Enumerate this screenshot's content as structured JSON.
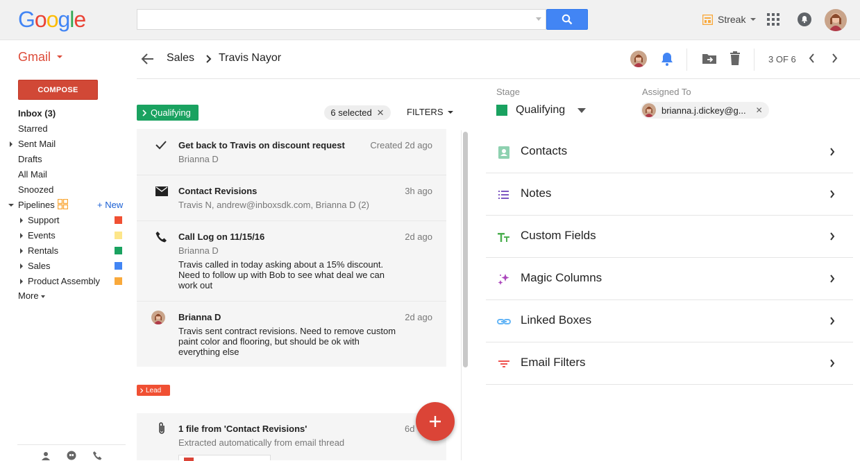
{
  "topbar": {
    "logo": "Google",
    "search": {
      "value": "",
      "placeholder": ""
    },
    "streak_label": "Streak"
  },
  "sidebar": {
    "app_label": "Gmail",
    "compose_label": "COMPOSE",
    "items": [
      {
        "label": "Inbox (3)"
      },
      {
        "label": "Starred"
      },
      {
        "label": "Sent Mail"
      },
      {
        "label": "Drafts"
      },
      {
        "label": "All Mail"
      },
      {
        "label": "Snoozed"
      },
      {
        "label": "Pipelines"
      }
    ],
    "new_label": "+ New",
    "pipelines": [
      {
        "label": "Support",
        "color": "#f05033"
      },
      {
        "label": "Events",
        "color": "#fde68a"
      },
      {
        "label": "Rentals",
        "color": "#1aa260"
      },
      {
        "label": "Sales",
        "color": "#4285f4"
      },
      {
        "label": "Product Assembly",
        "color": "#f9a93b"
      }
    ],
    "more_label": "More"
  },
  "header": {
    "breadcrumb_parent": "Sales",
    "breadcrumb_current": "Travis Nayor",
    "pager": "3 OF 6"
  },
  "toolbar": {
    "stage_pill": "Qualifying",
    "selected": "6 selected",
    "filters": "FILTERS"
  },
  "timeline": [
    {
      "icon": "check-icon",
      "title": "Get back to Travis on discount request",
      "sub": "Brianna D",
      "time": "Created 2d ago",
      "body": ""
    },
    {
      "icon": "email-icon",
      "title": "Contact Revisions",
      "sub": "Travis N, andrew@inboxsdk.com, Brianna D (2)",
      "time": "3h ago",
      "body": ""
    },
    {
      "icon": "phone-icon",
      "title": "Call Log on 11/15/16",
      "sub": "Brianna D",
      "time": "2d ago",
      "body": "Travis called in today asking about a 15% discount. Need to follow up with Bob to see what deal we can work out"
    },
    {
      "icon": "avatar",
      "title": "Brianna D",
      "sub": "",
      "time": "2d ago",
      "body": "Travis sent contract revisions. Need to remove custom paint color and flooring, but should be ok with everything else"
    }
  ],
  "lead_pill": "Lead",
  "file_row": {
    "title": "1 file from 'Contact Revisions'",
    "sub": "Extracted automatically from email thread",
    "time": "6d"
  },
  "panel": {
    "stage_label": "Stage",
    "stage_value": "Qualifying",
    "assigned_label": "Assigned To",
    "assigned_value": "brianna.j.dickey@g...",
    "rows": [
      {
        "label": "Contacts",
        "icon": "contacts-icon",
        "color": "#8ed1b0"
      },
      {
        "label": "Notes",
        "icon": "notes-icon",
        "color": "#7e57c2"
      },
      {
        "label": "Custom Fields",
        "icon": "custom-fields-icon",
        "color": "#4caf50"
      },
      {
        "label": "Magic Columns",
        "icon": "magic-icon",
        "color": "#ab47bc"
      },
      {
        "label": "Linked Boxes",
        "icon": "link-icon",
        "color": "#64b5f6"
      },
      {
        "label": "Email Filters",
        "icon": "filter-icon",
        "color": "#ef5350"
      }
    ]
  }
}
